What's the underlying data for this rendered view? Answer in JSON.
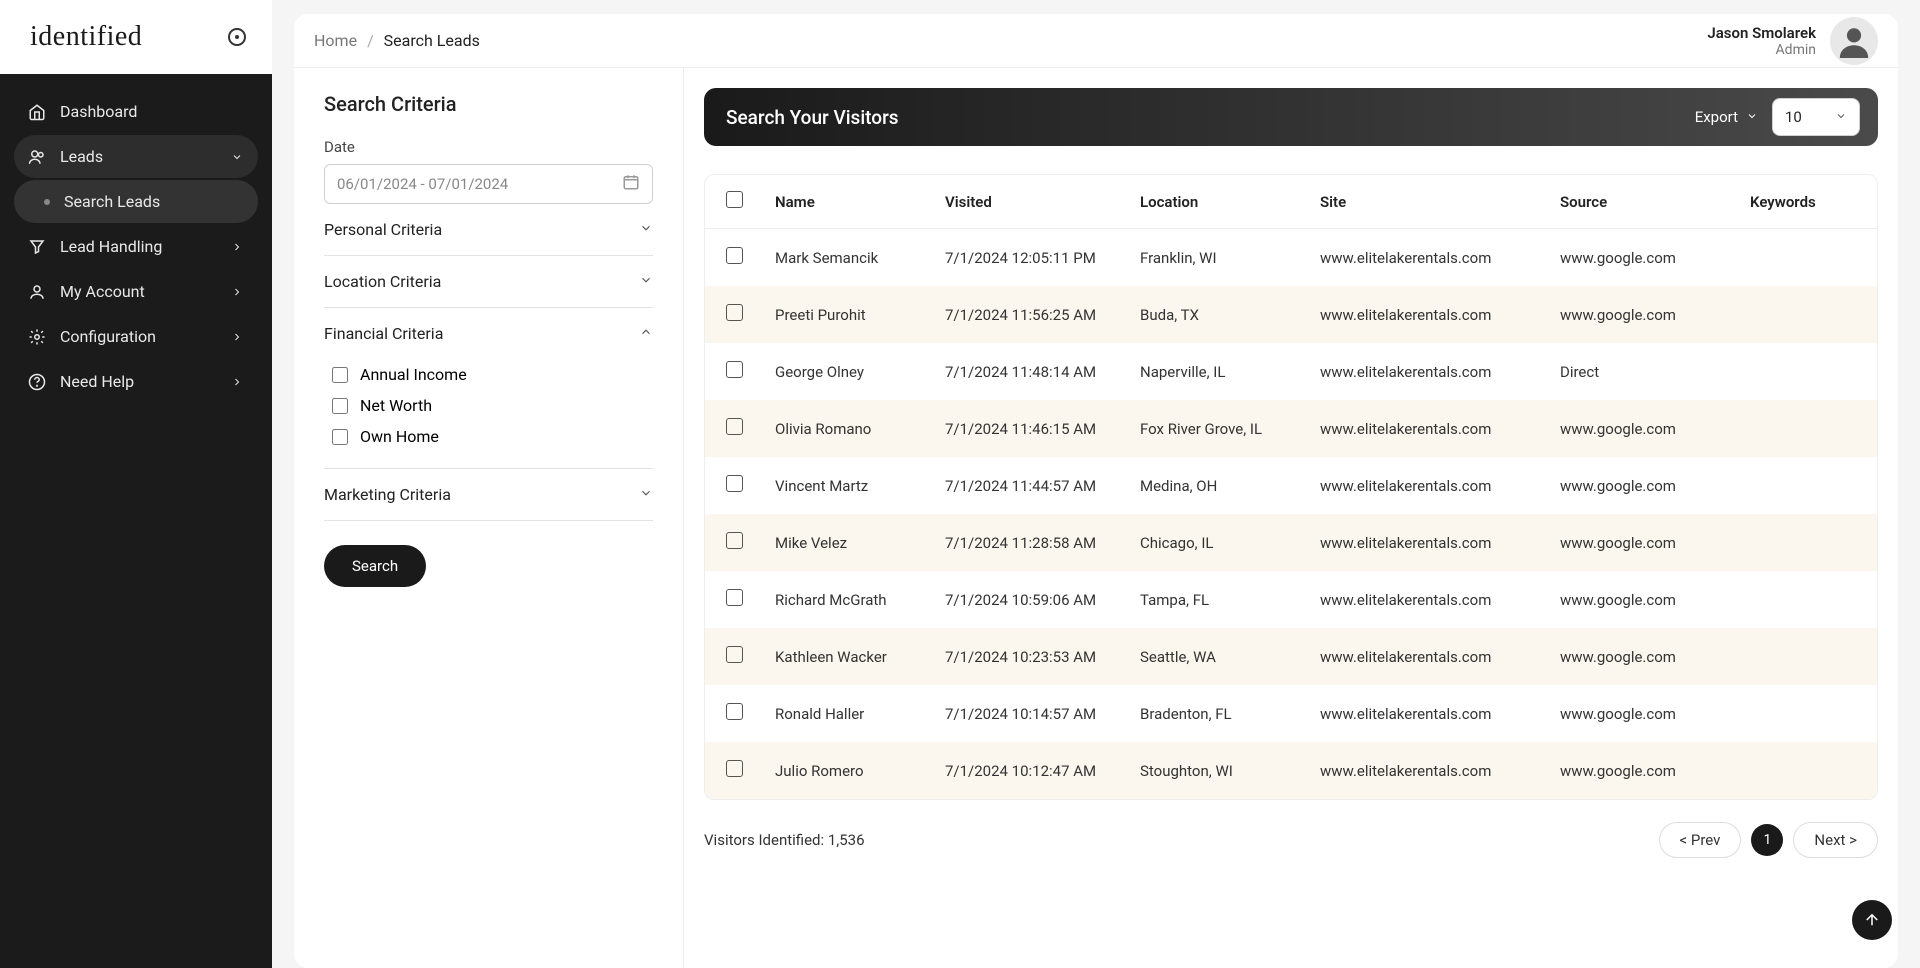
{
  "brand": "identified",
  "sidebar": {
    "items": [
      {
        "label": "Dashboard"
      },
      {
        "label": "Leads"
      },
      {
        "label": "Search Leads"
      },
      {
        "label": "Lead Handling"
      },
      {
        "label": "My Account"
      },
      {
        "label": "Configuration"
      },
      {
        "label": "Need Help"
      }
    ]
  },
  "breadcrumb": {
    "home": "Home",
    "current": "Search Leads"
  },
  "user": {
    "name": "Jason Smolarek",
    "role": "Admin"
  },
  "criteria": {
    "title": "Search Criteria",
    "date_label": "Date",
    "date_value": "06/01/2024 - 07/01/2024",
    "sections": {
      "personal": "Personal Criteria",
      "location": "Location Criteria",
      "financial": "Financial Criteria",
      "marketing": "Marketing Criteria"
    },
    "financial_options": {
      "annual_income": "Annual Income",
      "net_worth": "Net Worth",
      "own_home": "Own Home"
    },
    "search_button": "Search"
  },
  "results": {
    "title": "Search Your Visitors",
    "export": "Export",
    "page_size": "10",
    "columns": {
      "name": "Name",
      "visited": "Visited",
      "location": "Location",
      "site": "Site",
      "source": "Source",
      "keywords": "Keywords"
    },
    "rows": [
      {
        "name": "Mark Semancik",
        "visited": "7/1/2024 12:05:11 PM",
        "location": "Franklin, WI",
        "site": "www.elitelakerentals.com",
        "source": "www.google.com",
        "keywords": ""
      },
      {
        "name": "Preeti Purohit",
        "visited": "7/1/2024 11:56:25 AM",
        "location": "Buda, TX",
        "site": "www.elitelakerentals.com",
        "source": "www.google.com",
        "keywords": ""
      },
      {
        "name": "George Olney",
        "visited": "7/1/2024 11:48:14 AM",
        "location": "Naperville, IL",
        "site": "www.elitelakerentals.com",
        "source": "Direct",
        "keywords": ""
      },
      {
        "name": "Olivia Romano",
        "visited": "7/1/2024 11:46:15 AM",
        "location": "Fox River Grove, IL",
        "site": "www.elitelakerentals.com",
        "source": "www.google.com",
        "keywords": ""
      },
      {
        "name": "Vincent Martz",
        "visited": "7/1/2024 11:44:57 AM",
        "location": "Medina, OH",
        "site": "www.elitelakerentals.com",
        "source": "www.google.com",
        "keywords": ""
      },
      {
        "name": "Mike Velez",
        "visited": "7/1/2024 11:28:58 AM",
        "location": "Chicago, IL",
        "site": "www.elitelakerentals.com",
        "source": "www.google.com",
        "keywords": ""
      },
      {
        "name": "Richard McGrath",
        "visited": "7/1/2024 10:59:06 AM",
        "location": "Tampa, FL",
        "site": "www.elitelakerentals.com",
        "source": "www.google.com",
        "keywords": ""
      },
      {
        "name": "Kathleen Wacker",
        "visited": "7/1/2024 10:23:53 AM",
        "location": "Seattle, WA",
        "site": "www.elitelakerentals.com",
        "source": "www.google.com",
        "keywords": ""
      },
      {
        "name": "Ronald Haller",
        "visited": "7/1/2024 10:14:57 AM",
        "location": "Bradenton, FL",
        "site": "www.elitelakerentals.com",
        "source": "www.google.com",
        "keywords": ""
      },
      {
        "name": "Julio Romero",
        "visited": "7/1/2024 10:12:47 AM",
        "location": "Stoughton, WI",
        "site": "www.elitelakerentals.com",
        "source": "www.google.com",
        "keywords": ""
      }
    ],
    "count_label": "Visitors Identified: 1,536",
    "prev": "< Prev",
    "page": "1",
    "next": "Next >"
  }
}
